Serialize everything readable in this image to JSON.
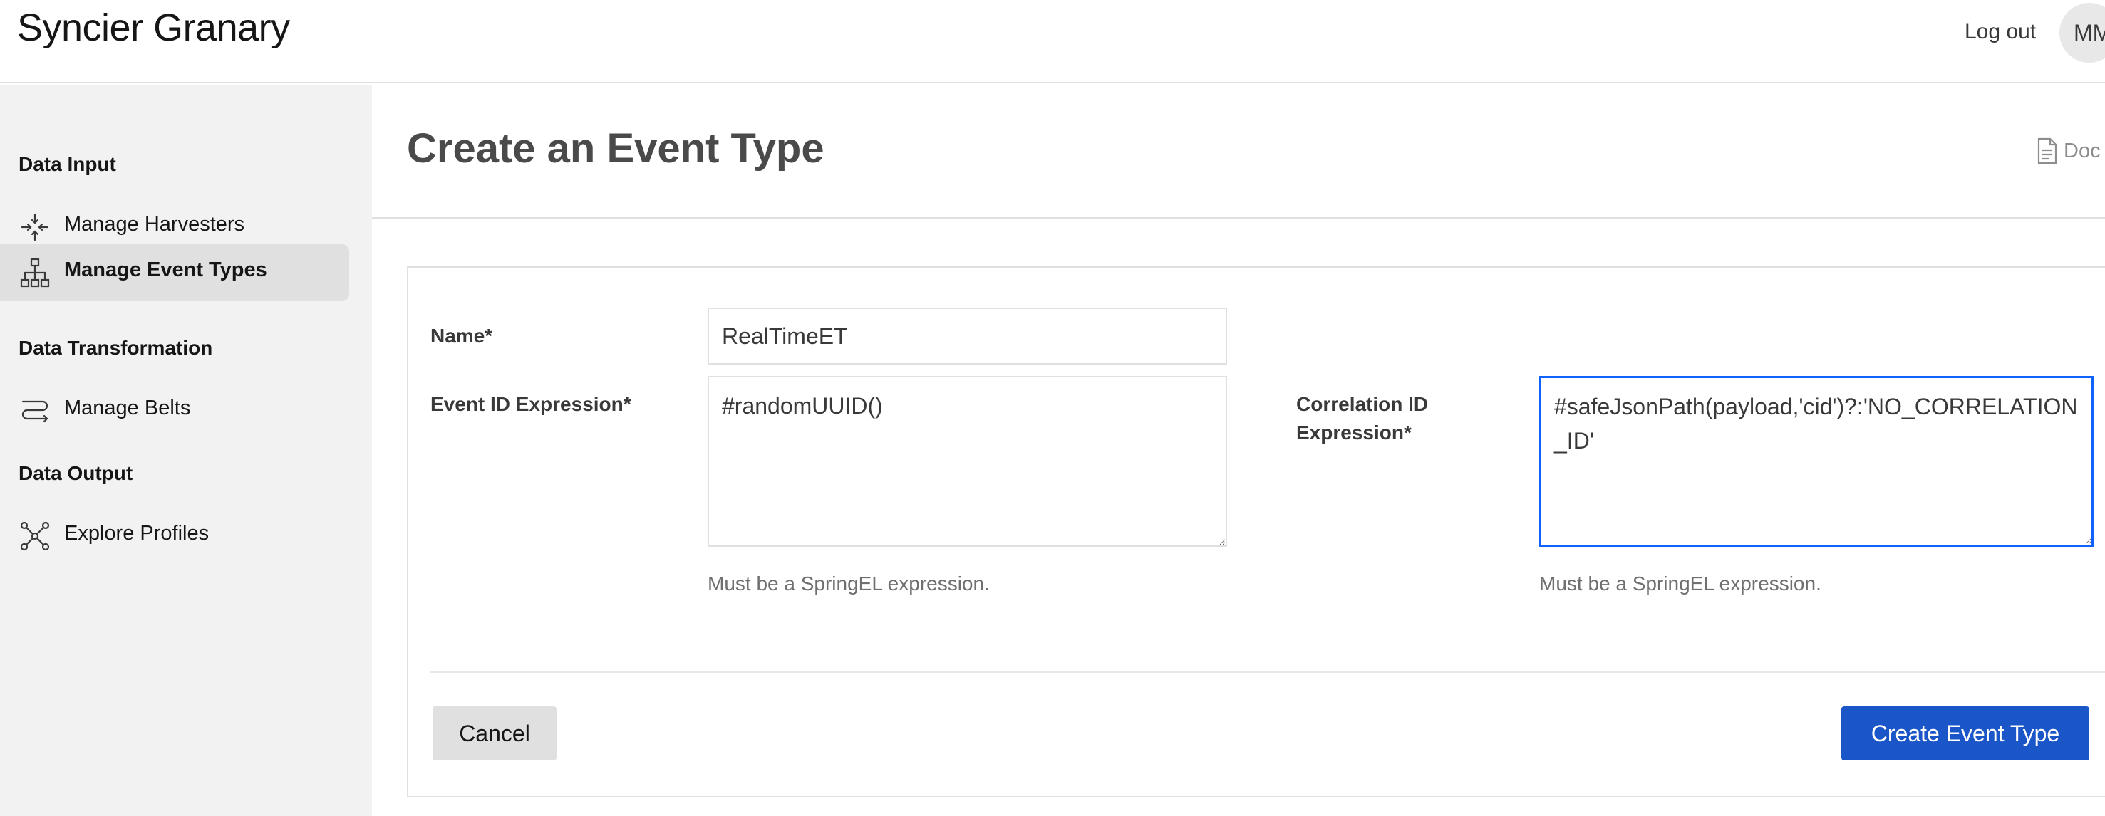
{
  "app": {
    "title": "Syncier Granary"
  },
  "header": {
    "logout_label": "Log out",
    "avatar_initials": "MM"
  },
  "sidebar": {
    "sections": [
      {
        "label": "Data Input",
        "items": [
          {
            "label": "Manage Harvesters",
            "icon": "harvesters-icon",
            "active": false
          },
          {
            "label": "Manage Event Types",
            "icon": "hierarchy-icon",
            "active": true
          }
        ]
      },
      {
        "label": "Data Transformation",
        "items": [
          {
            "label": "Manage Belts",
            "icon": "belt-icon",
            "active": false
          }
        ]
      },
      {
        "label": "Data Output",
        "items": [
          {
            "label": "Explore Profiles",
            "icon": "network-icon",
            "active": false
          }
        ]
      }
    ]
  },
  "main": {
    "title": "Create an Event Type",
    "docs_label": "Doc",
    "form": {
      "name_label": "Name*",
      "name_value": "RealTimeET",
      "event_id_label": "Event ID Expression*",
      "event_id_value": "#randomUUID()",
      "event_id_helper": "Must be a SpringEL expression.",
      "correlation_label_line1": "Correlation ID",
      "correlation_label_line2": "Expression*",
      "correlation_value": "#safeJsonPath(payload,'cid')?:'NO_CORRELATION_ID'",
      "correlation_helper": "Must be a SpringEL expression.",
      "cancel_label": "Cancel",
      "submit_label": "Create Event Type"
    }
  },
  "colors": {
    "accent": "#1a56c7",
    "focus": "#0f62fe",
    "sidebar_bg": "#f2f2f2"
  }
}
